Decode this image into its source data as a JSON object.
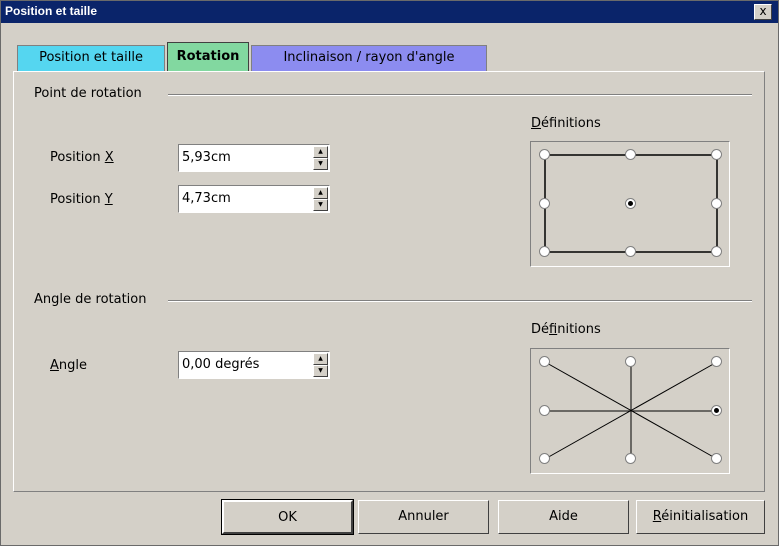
{
  "window": {
    "title": "Position et taille",
    "close_label": "x"
  },
  "tabs": [
    {
      "label": "Position et taille",
      "color": "#55d6f0"
    },
    {
      "label": "Rotation",
      "color": "#82d8a0"
    },
    {
      "label": "Inclinaison / rayon d'angle",
      "color": "#8c8cf0"
    }
  ],
  "pivot": {
    "section": "Point de rotation",
    "x_label_pre": "Position ",
    "x_label_key": "X",
    "y_label_pre": "Position ",
    "y_label_key": "Y",
    "x_value": "5,93cm",
    "y_value": "4,73cm",
    "definitions_key": "D",
    "definitions_rest": "éfinitions",
    "selected": "center"
  },
  "angle": {
    "section": "Angle de rotation",
    "label_key": "A",
    "label_rest": "ngle",
    "value": "0,00 degrés",
    "definitions_pre": "Dé",
    "definitions_key": "f",
    "definitions_rest": "initions",
    "selected": "0"
  },
  "buttons": {
    "ok": "OK",
    "cancel": "Annuler",
    "help": "Aide",
    "reset_key": "R",
    "reset_rest": "éinitialisation"
  }
}
